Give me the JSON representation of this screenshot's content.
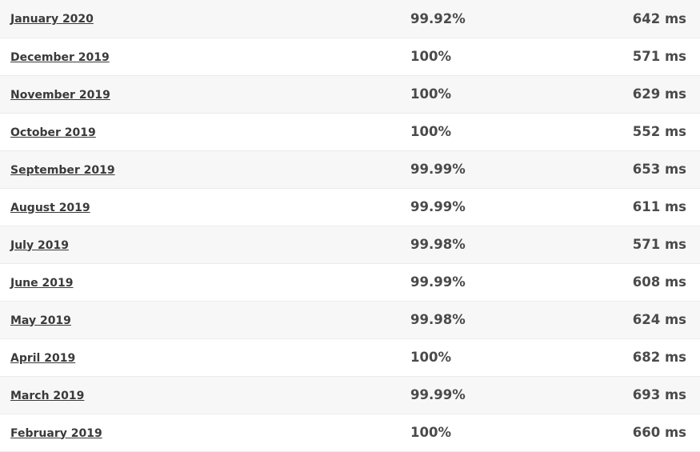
{
  "table": {
    "rows": [
      {
        "month": "January 2020",
        "uptime": "99.92%",
        "response_time": "642 ms"
      },
      {
        "month": "December 2019",
        "uptime": "100%",
        "response_time": "571 ms"
      },
      {
        "month": "November 2019",
        "uptime": "100%",
        "response_time": "629 ms"
      },
      {
        "month": "October 2019",
        "uptime": "100%",
        "response_time": "552 ms"
      },
      {
        "month": "September 2019",
        "uptime": "99.99%",
        "response_time": "653 ms"
      },
      {
        "month": "August 2019",
        "uptime": "99.99%",
        "response_time": "611 ms"
      },
      {
        "month": "July 2019",
        "uptime": "99.98%",
        "response_time": "571 ms"
      },
      {
        "month": "June 2019",
        "uptime": "99.99%",
        "response_time": "608 ms"
      },
      {
        "month": "May 2019",
        "uptime": "99.98%",
        "response_time": "624 ms"
      },
      {
        "month": "April 2019",
        "uptime": "100%",
        "response_time": "682 ms"
      },
      {
        "month": "March 2019",
        "uptime": "99.99%",
        "response_time": "693 ms"
      },
      {
        "month": "February 2019",
        "uptime": "100%",
        "response_time": "660 ms"
      }
    ]
  }
}
